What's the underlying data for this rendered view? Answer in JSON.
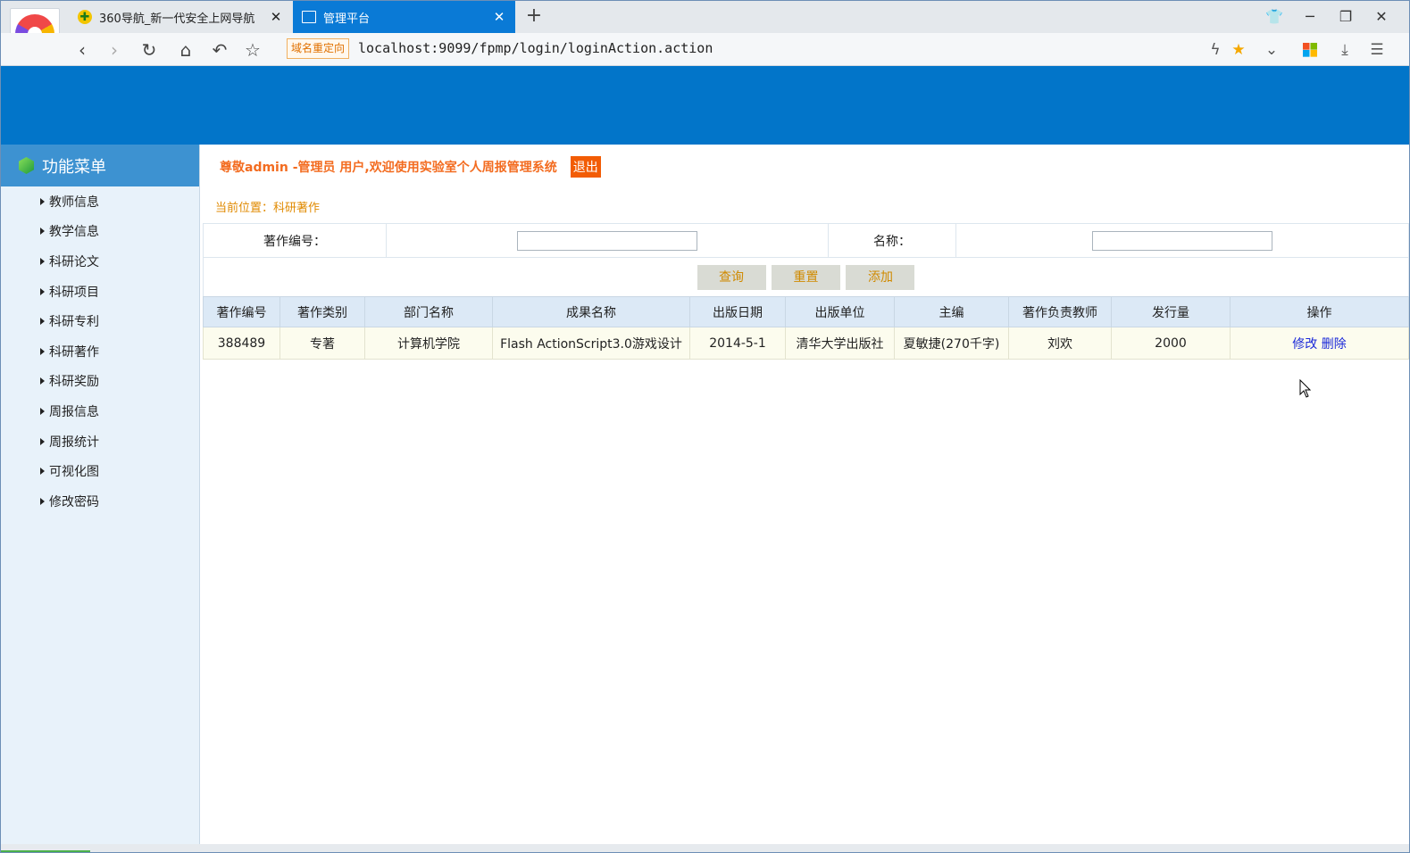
{
  "browser": {
    "tabs": [
      {
        "title": "360导航_新一代安全上网导航",
        "icon": "nav360-icon",
        "active": false
      },
      {
        "title": "管理平台",
        "icon": "document-icon",
        "active": true
      }
    ],
    "url_badge": "域名重定向",
    "url": "localhost:9099/fpmp/login/loginAction.action"
  },
  "sidebar": {
    "title": "功能菜单",
    "items": [
      {
        "label": "教师信息"
      },
      {
        "label": "教学信息"
      },
      {
        "label": "科研论文"
      },
      {
        "label": "科研项目"
      },
      {
        "label": "科研专利"
      },
      {
        "label": "科研著作"
      },
      {
        "label": "科研奖励"
      },
      {
        "label": "周报信息"
      },
      {
        "label": "周报统计"
      },
      {
        "label": "可视化图"
      },
      {
        "label": "修改密码"
      }
    ]
  },
  "main": {
    "welcome": "尊敬admin -管理员 用户,欢迎使用实验室个人周报管理系统",
    "logout": "退出",
    "breadcrumb": "当前位置：科研著作",
    "search": {
      "code_label": "著作编号：",
      "code_value": "",
      "name_label": "名称：",
      "name_value": "",
      "query_button": "查询",
      "reset_button": "重置",
      "add_button": "添加"
    },
    "table": {
      "headers": [
        "著作编号",
        "著作类别",
        "部门名称",
        "成果名称",
        "出版日期",
        "出版单位",
        "主编",
        "著作负责教师",
        "发行量",
        "操作"
      ],
      "rows": [
        {
          "cells": [
            "388489",
            "专著",
            "计算机学院",
            "Flash ActionScript3.0游戏设计",
            "2014-5-1",
            "清华大学出版社",
            "夏敏捷(270千字)",
            "刘欢",
            "2000"
          ],
          "edit": "修改",
          "delete": "删除"
        }
      ]
    }
  },
  "colors": {
    "header_blue": "#0275c9",
    "sidebar_title": "#3d92d1",
    "welcome_orange": "#f36c20",
    "breadcrumb": "#e08a00",
    "link_blue": "#1a28d8"
  }
}
